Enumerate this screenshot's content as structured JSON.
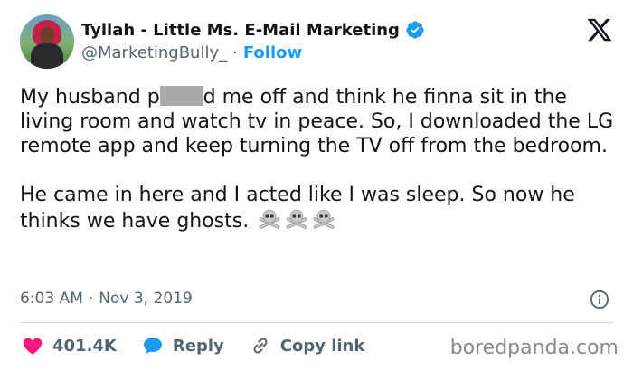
{
  "author": {
    "display_name": "Tyllah - Little Ms. E-Mail Marketing",
    "handle": "@MarketingBully_",
    "separator": "·",
    "follow_label": "Follow",
    "verified": true
  },
  "icons": {
    "verified": "verified-badge-icon",
    "platform": "x-logo-icon",
    "info": "info-icon",
    "like": "heart-icon",
    "reply": "reply-bubble-icon",
    "copy": "link-icon",
    "emoji": "skull-and-crossbones"
  },
  "tweet": {
    "text_before_redaction": "My husband p",
    "text_after_redaction": "d me off and think he finna sit in the living room and watch tv in peace. So, I downloaded the LG remote app and keep turning the TV off from the bedroom.\n\nHe came in here and I acted like I was sleep. So now he thinks we have ghosts. "
  },
  "meta": {
    "time": "6:03 AM",
    "separator": "·",
    "date": "Nov 3, 2019"
  },
  "actions": {
    "like_count": "401.4K",
    "reply_label": "Reply",
    "copy_link_label": "Copy link"
  },
  "watermark": "boredpanda.com",
  "colors": {
    "accent": "#1d9bf0",
    "like": "#f91880",
    "text": "#0f1419",
    "muted": "#536471"
  }
}
